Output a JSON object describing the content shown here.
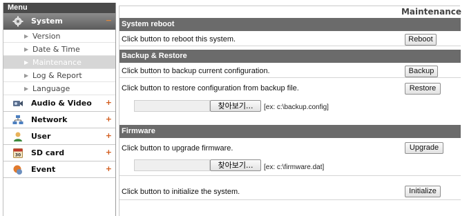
{
  "menu": {
    "header": "Menu",
    "sections": [
      {
        "label": "System",
        "icon": "system-gear-icon",
        "expand": "−",
        "active": true,
        "items": [
          {
            "label": "Version"
          },
          {
            "label": "Date & Time"
          },
          {
            "label": "Maintenance",
            "active": true
          },
          {
            "label": "Log & Report"
          },
          {
            "label": "Language"
          }
        ]
      },
      {
        "label": "Audio & Video",
        "icon": "audio-video-icon",
        "expand": "+"
      },
      {
        "label": "Network",
        "icon": "network-icon",
        "expand": "+"
      },
      {
        "label": "User",
        "icon": "user-icon",
        "expand": "+"
      },
      {
        "label": "SD card",
        "icon": "sd-card-icon",
        "expand": "+"
      },
      {
        "label": "Event",
        "icon": "event-icon",
        "expand": "+"
      }
    ]
  },
  "page": {
    "title": "Maintenance",
    "reboot": {
      "heading": "System reboot",
      "text": "Click button to reboot this system.",
      "button": "Reboot"
    },
    "backup": {
      "heading": "Backup & Restore",
      "backup_text": "Click button to backup current configuration.",
      "backup_button": "Backup",
      "restore_text": "Click button to restore configuration from backup file.",
      "restore_button": "Restore",
      "file_value": "",
      "browse_label": "찾아보기...",
      "hint": "[ex: c:\\backup.config]"
    },
    "firmware": {
      "heading": "Firmware",
      "text": "Click button to upgrade firmware.",
      "button": "Upgrade",
      "file_value": "",
      "browse_label": "찾아보기...",
      "hint": "[ex: c:\\firmware.dat]"
    },
    "initialize": {
      "text": "Click button to initialize the system.",
      "button": "Initialize"
    }
  },
  "colors": {
    "section_bar": "#6b6b6b",
    "menu_header": "#4a4a4a",
    "expand_plus": "#d25a1a"
  }
}
